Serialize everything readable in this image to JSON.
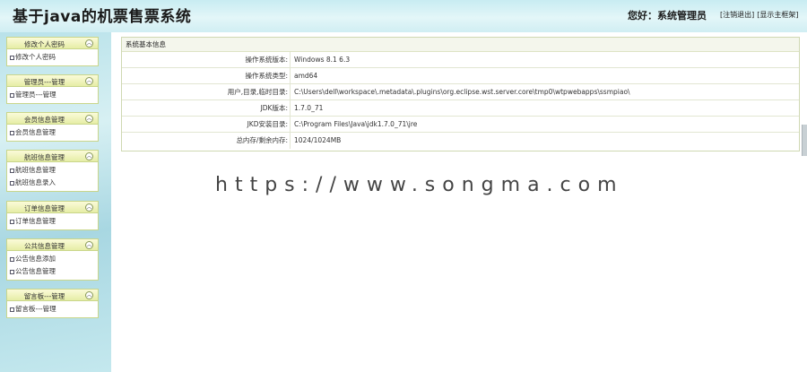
{
  "header": {
    "app_title": "基于java的机票售票系统",
    "greeting": "您好：系统管理员",
    "logout": "[注销退出]",
    "home": "[显示主框架]"
  },
  "sidebar": {
    "groups": [
      {
        "title": "修改个人密码",
        "items": [
          "修改个人密码"
        ]
      },
      {
        "title": "管理员---管理",
        "items": [
          "管理员---管理"
        ]
      },
      {
        "title": "会员信息管理",
        "items": [
          "会员信息管理"
        ]
      },
      {
        "title": "航班信息管理",
        "items": [
          "航班信息管理",
          "航班信息录入"
        ]
      },
      {
        "title": "订单信息管理",
        "items": [
          "订单信息管理"
        ]
      },
      {
        "title": "公共信息管理",
        "items": [
          "公告信息添加",
          "公告信息管理"
        ]
      },
      {
        "title": "留言板---管理",
        "items": [
          "留言板---管理"
        ]
      }
    ]
  },
  "panel": {
    "title": "系统基本信息",
    "rows": [
      {
        "label": "操作系统版本:",
        "value": "Windows 8.1  6.3"
      },
      {
        "label": "操作系统类型:",
        "value": "amd64"
      },
      {
        "label": "用户,目录,临时目录:",
        "value": "C:\\Users\\dell\\workspace\\.metadata\\.plugins\\org.eclipse.wst.server.core\\tmp0\\wtpwebapps\\ssmpiao\\"
      },
      {
        "label": "JDK版本:",
        "value": "1.7.0_71"
      },
      {
        "label": "JKD安装目录:",
        "value": "C:\\Program Files\\Java\\jdk1.7.0_71\\jre"
      },
      {
        "label": "总内存/剩余内存:",
        "value": "1024/1024MB"
      }
    ]
  },
  "watermark": "https://www.songma.com",
  "icons": {
    "collapse": "chevron-up-icon",
    "bullet": "bullet-icon"
  }
}
